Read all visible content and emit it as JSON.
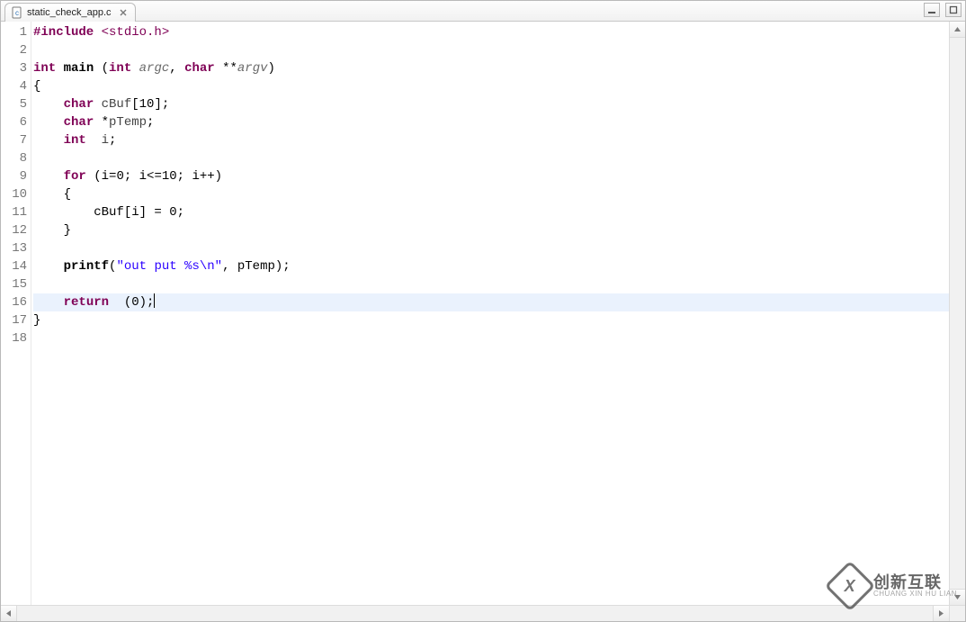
{
  "tab": {
    "filename": "static_check_app.c",
    "icon": "c-file-icon",
    "close": "close-icon"
  },
  "window": {
    "minimize": "minimize-icon",
    "maximize": "maximize-icon"
  },
  "editor": {
    "current_line": 16,
    "lines": [
      {
        "n": 1,
        "tokens": [
          {
            "t": "#include ",
            "c": "pp"
          },
          {
            "t": "<stdio.h>",
            "c": "inc"
          }
        ]
      },
      {
        "n": 2,
        "tokens": []
      },
      {
        "n": 3,
        "tokens": [
          {
            "t": "int ",
            "c": "type"
          },
          {
            "t": "main ",
            "c": "fn"
          },
          {
            "t": "(",
            "c": "op"
          },
          {
            "t": "int ",
            "c": "type"
          },
          {
            "t": "argc",
            "c": "var"
          },
          {
            "t": ", ",
            "c": "op"
          },
          {
            "t": "char ",
            "c": "type"
          },
          {
            "t": "**",
            "c": "op"
          },
          {
            "t": "argv",
            "c": "var"
          },
          {
            "t": ")",
            "c": "op"
          }
        ]
      },
      {
        "n": 4,
        "tokens": [
          {
            "t": "{",
            "c": "op"
          }
        ]
      },
      {
        "n": 5,
        "tokens": [
          {
            "t": "    ",
            "c": ""
          },
          {
            "t": "char ",
            "c": "type"
          },
          {
            "t": "cBuf",
            "c": "id"
          },
          {
            "t": "[",
            "c": "op"
          },
          {
            "t": "10",
            "c": "num"
          },
          {
            "t": "];",
            "c": "op"
          }
        ]
      },
      {
        "n": 6,
        "tokens": [
          {
            "t": "    ",
            "c": ""
          },
          {
            "t": "char ",
            "c": "type"
          },
          {
            "t": "*",
            "c": "op"
          },
          {
            "t": "pTemp",
            "c": "id"
          },
          {
            "t": ";",
            "c": "op"
          }
        ]
      },
      {
        "n": 7,
        "tokens": [
          {
            "t": "    ",
            "c": ""
          },
          {
            "t": "int  ",
            "c": "type"
          },
          {
            "t": "i",
            "c": "id"
          },
          {
            "t": ";",
            "c": "op"
          }
        ]
      },
      {
        "n": 8,
        "tokens": []
      },
      {
        "n": 9,
        "tokens": [
          {
            "t": "    ",
            "c": ""
          },
          {
            "t": "for ",
            "c": "kw"
          },
          {
            "t": "(i",
            "c": "op"
          },
          {
            "t": "=",
            "c": "op"
          },
          {
            "t": "0",
            "c": "num"
          },
          {
            "t": "; i<",
            "c": "op"
          },
          {
            "t": "=",
            "c": "op"
          },
          {
            "t": "10",
            "c": "num"
          },
          {
            "t": "; i++)",
            "c": "op"
          }
        ]
      },
      {
        "n": 10,
        "tokens": [
          {
            "t": "    {",
            "c": "op"
          }
        ]
      },
      {
        "n": 11,
        "tokens": [
          {
            "t": "        cBuf[i] ",
            "c": "op"
          },
          {
            "t": "=",
            "c": "op"
          },
          {
            "t": " ",
            "c": ""
          },
          {
            "t": "0",
            "c": "num"
          },
          {
            "t": ";",
            "c": "op"
          }
        ]
      },
      {
        "n": 12,
        "tokens": [
          {
            "t": "    }",
            "c": "op"
          }
        ]
      },
      {
        "n": 13,
        "tokens": []
      },
      {
        "n": 14,
        "tokens": [
          {
            "t": "    ",
            "c": ""
          },
          {
            "t": "printf",
            "c": "fn"
          },
          {
            "t": "(",
            "c": "op"
          },
          {
            "t": "\"out put %s\\n\"",
            "c": "str"
          },
          {
            "t": ", pTemp);",
            "c": "op"
          }
        ]
      },
      {
        "n": 15,
        "tokens": []
      },
      {
        "n": 16,
        "tokens": [
          {
            "t": "    ",
            "c": ""
          },
          {
            "t": "return  ",
            "c": "kw"
          },
          {
            "t": "(",
            "c": "op"
          },
          {
            "t": "0",
            "c": "num"
          },
          {
            "t": ");",
            "c": "op"
          }
        ],
        "caret": true
      },
      {
        "n": 17,
        "tokens": [
          {
            "t": "}",
            "c": "op"
          }
        ]
      },
      {
        "n": 18,
        "tokens": []
      }
    ]
  },
  "watermark": {
    "cn": "创新互联",
    "en": "CHUANG XIN HU LIAN"
  }
}
